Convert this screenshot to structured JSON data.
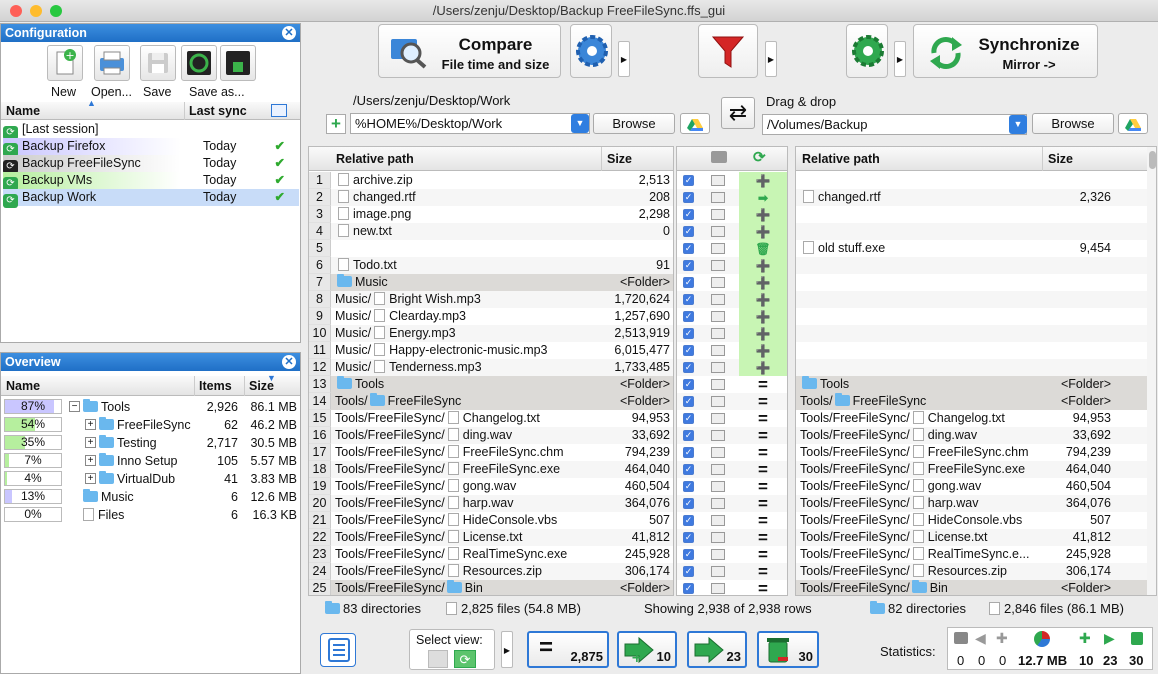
{
  "window": {
    "title": "/Users/zenju/Desktop/Backup FreeFileSync.ffs_gui"
  },
  "config": {
    "title": "Configuration",
    "toolbar": [
      {
        "label": "New",
        "icon": "new-file-icon"
      },
      {
        "label": "Open...",
        "icon": "open-printer-icon"
      },
      {
        "label": "Save",
        "icon": "save-disk-icon"
      },
      {
        "label": "Save as...",
        "icon": "save-as-icon"
      }
    ],
    "col_name": "Name",
    "col_last": "Last sync",
    "items": [
      {
        "name": "[Last session]",
        "last": ""
      },
      {
        "name": "Backup Firefox",
        "last": "Today"
      },
      {
        "name": "Backup FreeFileSync",
        "last": "Today"
      },
      {
        "name": "Backup VMs",
        "last": "Today"
      },
      {
        "name": "Backup Work",
        "last": "Today"
      }
    ]
  },
  "overview": {
    "title": "Overview",
    "col_name": "Name",
    "col_items": "Items",
    "col_size": "Size",
    "rows": [
      {
        "pct": "87%",
        "fill": 0.87,
        "name": "Tools",
        "items": "2,926",
        "size": "86.1 MB",
        "indent": 0,
        "exp": "−",
        "type": "folder"
      },
      {
        "pct": "54%",
        "fill": 0.54,
        "name": "FreeFileSync",
        "items": "62",
        "size": "46.2 MB",
        "indent": 1,
        "exp": "+",
        "type": "folder"
      },
      {
        "pct": "35%",
        "fill": 0.35,
        "name": "Testing",
        "items": "2,717",
        "size": "30.5 MB",
        "indent": 1,
        "exp": "+",
        "type": "folder"
      },
      {
        "pct": "7%",
        "fill": 0.07,
        "name": "Inno Setup",
        "items": "105",
        "size": "5.57 MB",
        "indent": 1,
        "exp": "+",
        "type": "folder"
      },
      {
        "pct": "4%",
        "fill": 0.04,
        "name": "VirtualDub",
        "items": "41",
        "size": "3.83 MB",
        "indent": 1,
        "exp": "+",
        "type": "folder"
      },
      {
        "pct": "13%",
        "fill": 0.13,
        "name": "Music",
        "items": "6",
        "size": "12.6 MB",
        "indent": 0,
        "exp": "",
        "type": "folder"
      },
      {
        "pct": "0%",
        "fill": 0.0,
        "name": "Files",
        "items": "6",
        "size": "16.3 KB",
        "indent": 0,
        "exp": "",
        "type": "file"
      }
    ]
  },
  "toolbar": {
    "compare_title": "Compare",
    "compare_sub": "File time and size",
    "sync_title": "Synchronize",
    "sync_sub": "Mirror ->"
  },
  "left_folder": {
    "path_label": "/Users/zenju/Desktop/Work",
    "input": "%HOME%/Desktop/Work",
    "browse": "Browse"
  },
  "right_folder": {
    "path_label": "Drag & drop",
    "input": "/Volumes/Backup",
    "browse": "Browse"
  },
  "grid": {
    "col_rel": "Relative path",
    "col_size": "Size",
    "left_rows": [
      {
        "n": "1",
        "prefix": "",
        "name": "archive.zip",
        "size": "2,513",
        "type": "zip"
      },
      {
        "n": "2",
        "prefix": "",
        "name": "changed.rtf",
        "size": "208",
        "type": "file"
      },
      {
        "n": "3",
        "prefix": "",
        "name": "image.png",
        "size": "2,298",
        "type": "file"
      },
      {
        "n": "4",
        "prefix": "",
        "name": "new.txt",
        "size": "0",
        "type": "file"
      },
      {
        "n": "5",
        "prefix": "",
        "name": "",
        "size": "",
        "type": "none"
      },
      {
        "n": "6",
        "prefix": "",
        "name": "Todo.txt",
        "size": "91",
        "type": "file"
      },
      {
        "n": "7",
        "prefix": "",
        "name": "Music",
        "size": "<Folder>",
        "type": "folder"
      },
      {
        "n": "8",
        "prefix": "Music/",
        "name": "Bright Wish.mp3",
        "size": "1,720,624",
        "type": "file"
      },
      {
        "n": "9",
        "prefix": "Music/",
        "name": "Clearday.mp3",
        "size": "1,257,690",
        "type": "file"
      },
      {
        "n": "10",
        "prefix": "Music/",
        "name": "Energy.mp3",
        "size": "2,513,919",
        "type": "file"
      },
      {
        "n": "11",
        "prefix": "Music/",
        "name": "Happy-electronic-music.mp3",
        "size": "6,015,477",
        "type": "file"
      },
      {
        "n": "12",
        "prefix": "Music/",
        "name": "Tenderness.mp3",
        "size": "1,733,485",
        "type": "file"
      },
      {
        "n": "13",
        "prefix": "",
        "name": "Tools",
        "size": "<Folder>",
        "type": "folder"
      },
      {
        "n": "14",
        "prefix": "Tools/",
        "name": "FreeFileSync",
        "size": "<Folder>",
        "type": "folder"
      },
      {
        "n": "15",
        "prefix": "Tools/FreeFileSync/",
        "name": "Changelog.txt",
        "size": "94,953",
        "type": "file"
      },
      {
        "n": "16",
        "prefix": "Tools/FreeFileSync/",
        "name": "ding.wav",
        "size": "33,692",
        "type": "file"
      },
      {
        "n": "17",
        "prefix": "Tools/FreeFileSync/",
        "name": "FreeFileSync.chm",
        "size": "794,239",
        "type": "file"
      },
      {
        "n": "18",
        "prefix": "Tools/FreeFileSync/",
        "name": "FreeFileSync.exe",
        "size": "464,040",
        "type": "file"
      },
      {
        "n": "19",
        "prefix": "Tools/FreeFileSync/",
        "name": "gong.wav",
        "size": "460,504",
        "type": "file"
      },
      {
        "n": "20",
        "prefix": "Tools/FreeFileSync/",
        "name": "harp.wav",
        "size": "364,076",
        "type": "file"
      },
      {
        "n": "21",
        "prefix": "Tools/FreeFileSync/",
        "name": "HideConsole.vbs",
        "size": "507",
        "type": "file"
      },
      {
        "n": "22",
        "prefix": "Tools/FreeFileSync/",
        "name": "License.txt",
        "size": "41,812",
        "type": "file"
      },
      {
        "n": "23",
        "prefix": "Tools/FreeFileSync/",
        "name": "RealTimeSync.exe",
        "size": "245,928",
        "type": "file"
      },
      {
        "n": "24",
        "prefix": "Tools/FreeFileSync/",
        "name": "Resources.zip",
        "size": "306,174",
        "type": "zip"
      },
      {
        "n": "25",
        "prefix": "Tools/FreeFileSync/",
        "name": "Bin",
        "size": "<Folder>",
        "type": "folder"
      }
    ],
    "mid_actions": [
      "plus",
      "arrow",
      "plus",
      "plus",
      "trash",
      "plus",
      "plus",
      "plus",
      "plus",
      "plus",
      "plus",
      "plus",
      "eq",
      "eq",
      "eq",
      "eq",
      "eq",
      "eq",
      "eq",
      "eq",
      "eq",
      "eq",
      "eq",
      "eq",
      "eq"
    ],
    "right_rows": [
      {
        "prefix": "",
        "name": "",
        "size": "",
        "type": "none"
      },
      {
        "prefix": "",
        "name": "changed.rtf",
        "size": "2,326",
        "type": "file"
      },
      {
        "prefix": "",
        "name": "",
        "size": "",
        "type": "none"
      },
      {
        "prefix": "",
        "name": "",
        "size": "",
        "type": "none"
      },
      {
        "prefix": "",
        "name": "old stuff.exe",
        "size": "9,454",
        "type": "file"
      },
      {
        "prefix": "",
        "name": "",
        "size": "",
        "type": "none"
      },
      {
        "prefix": "",
        "name": "",
        "size": "",
        "type": "none"
      },
      {
        "prefix": "",
        "name": "",
        "size": "",
        "type": "none"
      },
      {
        "prefix": "",
        "name": "",
        "size": "",
        "type": "none"
      },
      {
        "prefix": "",
        "name": "",
        "size": "",
        "type": "none"
      },
      {
        "prefix": "",
        "name": "",
        "size": "",
        "type": "none"
      },
      {
        "prefix": "",
        "name": "",
        "size": "",
        "type": "none"
      },
      {
        "prefix": "",
        "name": "Tools",
        "size": "<Folder>",
        "type": "folder"
      },
      {
        "prefix": "Tools/",
        "name": "FreeFileSync",
        "size": "<Folder>",
        "type": "folder"
      },
      {
        "prefix": "Tools/FreeFileSync/",
        "name": "Changelog.txt",
        "size": "94,953",
        "type": "file"
      },
      {
        "prefix": "Tools/FreeFileSync/",
        "name": "ding.wav",
        "size": "33,692",
        "type": "file"
      },
      {
        "prefix": "Tools/FreeFileSync/",
        "name": "FreeFileSync.chm",
        "size": "794,239",
        "type": "file"
      },
      {
        "prefix": "Tools/FreeFileSync/",
        "name": "FreeFileSync.exe",
        "size": "464,040",
        "type": "file"
      },
      {
        "prefix": "Tools/FreeFileSync/",
        "name": "gong.wav",
        "size": "460,504",
        "type": "file"
      },
      {
        "prefix": "Tools/FreeFileSync/",
        "name": "harp.wav",
        "size": "364,076",
        "type": "file"
      },
      {
        "prefix": "Tools/FreeFileSync/",
        "name": "HideConsole.vbs",
        "size": "507",
        "type": "file"
      },
      {
        "prefix": "Tools/FreeFileSync/",
        "name": "License.txt",
        "size": "41,812",
        "type": "file"
      },
      {
        "prefix": "Tools/FreeFileSync/",
        "name": "RealTimeSync.e...",
        "size": "245,928",
        "type": "file"
      },
      {
        "prefix": "Tools/FreeFileSync/",
        "name": "Resources.zip",
        "size": "306,174",
        "type": "zip"
      },
      {
        "prefix": "Tools/FreeFileSync/",
        "name": "Bin",
        "size": "<Folder>",
        "type": "folder"
      }
    ]
  },
  "statusbar": {
    "left_dirs": "83 directories",
    "left_files": "2,825 files",
    "left_size": "(54.8 MB)",
    "showing": "Showing 2,938 of 2,938 rows",
    "right_dirs": "82 directories",
    "right_files": "2,846 files",
    "right_size": "(86.1 MB)"
  },
  "bottom": {
    "select_view": "Select view:",
    "equal_count": "2,875",
    "create_count": "10",
    "update_count": "23",
    "delete_count": "30",
    "statistics_label": "Statistics:",
    "stats": [
      "0",
      "0",
      "0",
      "12.7 MB",
      "10",
      "23",
      "30"
    ]
  },
  "colors": {
    "accent": "#2e78d6",
    "header_blue": "#1f6fc6",
    "green": "#2faa2f",
    "folder_row": "#dcdad7",
    "green_col": "#c8f5b4"
  }
}
